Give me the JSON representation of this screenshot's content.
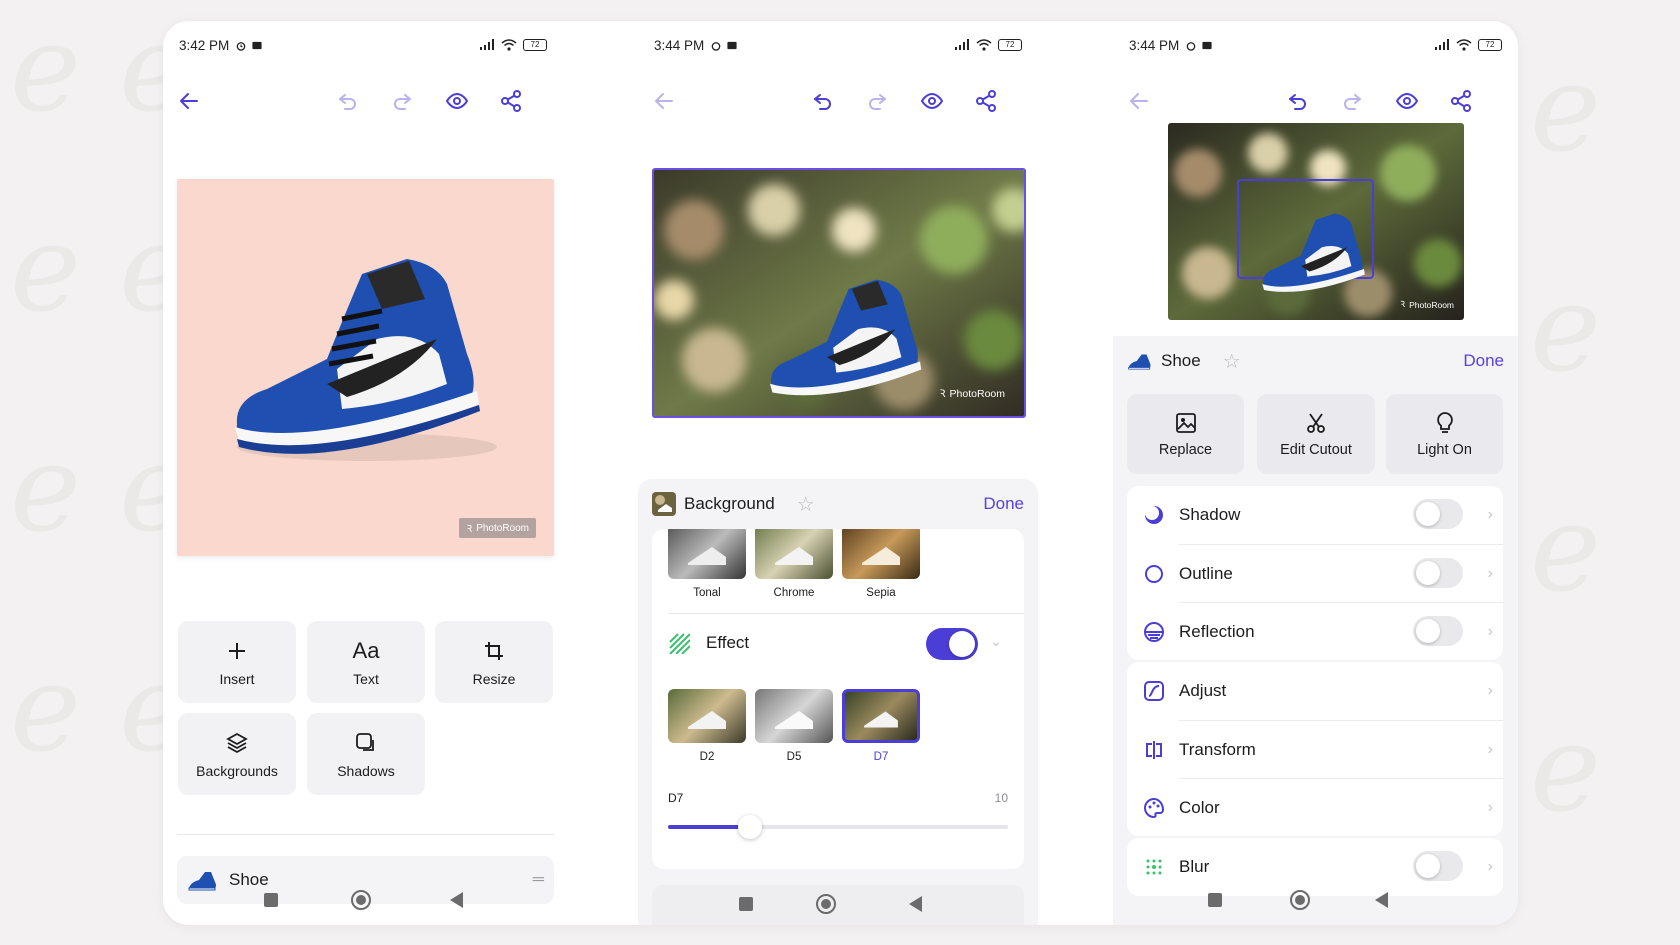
{
  "colors": {
    "accent": "#4b3ed6",
    "page_bg": "#f3f1f1",
    "canvas_pink": "#fad8cd"
  },
  "watermark_text": "PhotoRoom",
  "screens": [
    {
      "status": {
        "time": "3:42 PM",
        "battery": "72"
      },
      "tiles": [
        {
          "icon": "plus-icon",
          "label": "Insert"
        },
        {
          "icon": "text-icon",
          "label": "Text",
          "glyph": "Aa"
        },
        {
          "icon": "crop-icon",
          "label": "Resize"
        },
        {
          "icon": "layers-icon",
          "label": "Backgrounds"
        },
        {
          "icon": "shadow-icon",
          "label": "Shadows"
        }
      ],
      "layer": {
        "name": "Shoe"
      }
    },
    {
      "status": {
        "time": "3:44 PM",
        "battery": "72"
      },
      "panel": {
        "title": "Background",
        "done_label": "Done",
        "filters": [
          "Tonal",
          "Chrome",
          "Sepia"
        ],
        "effect": {
          "label": "Effect",
          "enabled": true
        },
        "effect_options": [
          "D2",
          "D5",
          "D7"
        ],
        "selected_option": "D7",
        "slider": {
          "label": "D7",
          "max_label": "10",
          "value": 2.4
        }
      }
    },
    {
      "status": {
        "time": "3:44 PM",
        "battery": "72"
      },
      "panel": {
        "title": "Shoe",
        "done_label": "Done",
        "quick_actions": [
          {
            "icon": "image-icon",
            "label": "Replace"
          },
          {
            "icon": "scissors-icon",
            "label": "Edit Cutout"
          },
          {
            "icon": "bulb-icon",
            "label": "Light On"
          }
        ],
        "toggles": [
          {
            "icon": "shadow-icon",
            "label": "Shadow",
            "on": false
          },
          {
            "icon": "outline-icon",
            "label": "Outline",
            "on": false
          },
          {
            "icon": "reflection-icon",
            "label": "Reflection",
            "on": false
          }
        ],
        "options": [
          {
            "icon": "adjust-icon",
            "label": "Adjust"
          },
          {
            "icon": "transform-icon",
            "label": "Transform"
          },
          {
            "icon": "palette-icon",
            "label": "Color"
          }
        ],
        "blur": {
          "icon": "blur-icon",
          "label": "Blur",
          "on": false
        }
      }
    }
  ]
}
